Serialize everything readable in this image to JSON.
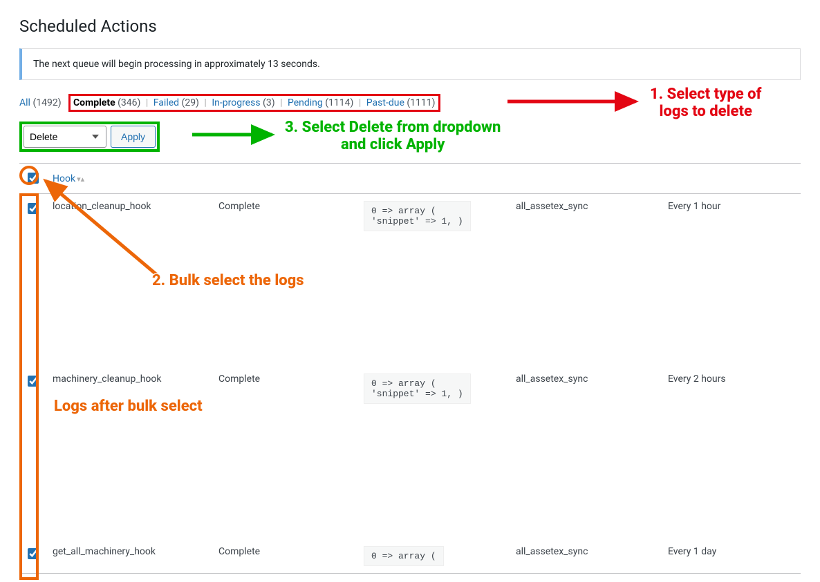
{
  "header": {
    "title": "Scheduled Actions"
  },
  "notice": {
    "text": "The next queue will begin processing in approximately 13 seconds."
  },
  "filters": {
    "all": {
      "label": "All",
      "count": "(1492)"
    },
    "complete": {
      "label": "Complete",
      "count": "(346)"
    },
    "failed": {
      "label": "Failed",
      "count": "(29)"
    },
    "inprogress": {
      "label": "In-progress",
      "count": "(3)"
    },
    "pending": {
      "label": "Pending",
      "count": "(1114)"
    },
    "pastdue": {
      "label": "Past-due",
      "count": "(1111)"
    }
  },
  "bulk": {
    "selected": "Delete",
    "apply": "Apply"
  },
  "table": {
    "header": {
      "hook": "Hook"
    },
    "rows": [
      {
        "hook": "location_cleanup_hook",
        "status": "Complete",
        "args_line1": "0 => array (",
        "args_line2": "'snippet' => 1, )",
        "group": "all_assetex_sync",
        "recurrence": "Every 1 hour"
      },
      {
        "hook": "machinery_cleanup_hook",
        "status": "Complete",
        "args_line1": "0 => array (",
        "args_line2": "'snippet' => 1, )",
        "group": "all_assetex_sync",
        "recurrence": "Every 2 hours"
      },
      {
        "hook": "get_all_machinery_hook",
        "status": "Complete",
        "args_line1": "0 => array (",
        "args_line2": "",
        "group": "all_assetex_sync",
        "recurrence": "Every 1 day"
      }
    ]
  },
  "annotations": {
    "step1": "1. Select type of\nlogs to delete",
    "step2": "2. Bulk select the logs",
    "step3": "3. Select Delete from dropdown\nand click Apply",
    "after": "Logs after bulk select"
  }
}
